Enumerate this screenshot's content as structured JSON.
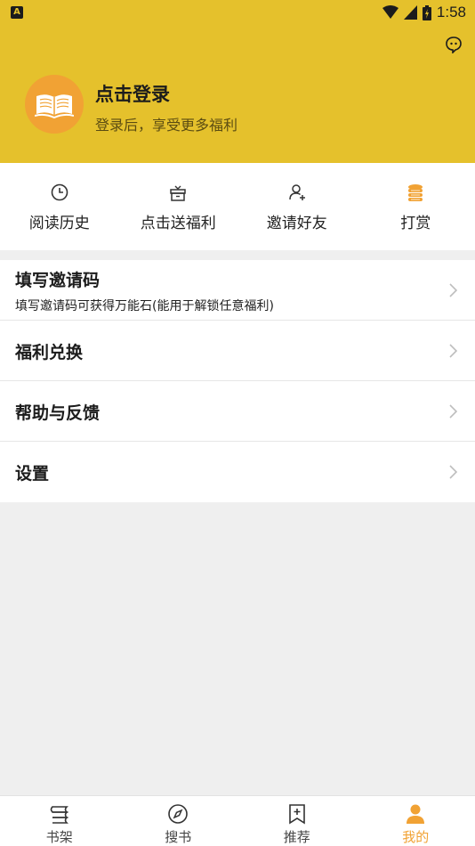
{
  "status": {
    "left_icon_letter": "A",
    "time": "1:58"
  },
  "profile": {
    "title": "点击登录",
    "subtitle": "登录后，享受更多福利"
  },
  "quick_actions": [
    {
      "label": "阅读历史",
      "icon": "clock-icon"
    },
    {
      "label": "点击送福利",
      "icon": "gift-icon"
    },
    {
      "label": "邀请好友",
      "icon": "add-user-icon"
    },
    {
      "label": "打赏",
      "icon": "coins-icon"
    }
  ],
  "menu": [
    {
      "title": "填写邀请码",
      "desc": "填写邀请码可获得万能石(能用于解锁任意福利)"
    },
    {
      "title": "福利兑换"
    },
    {
      "title": "帮助与反馈"
    },
    {
      "title": "设置"
    }
  ],
  "bottom_nav": [
    {
      "label": "书架",
      "icon": "bookshelf-icon"
    },
    {
      "label": "搜书",
      "icon": "compass-icon"
    },
    {
      "label": "推荐",
      "icon": "bookmark-plus-icon"
    },
    {
      "label": "我的",
      "icon": "person-icon",
      "active": true
    }
  ],
  "colors": {
    "header_bg": "#e5c12c",
    "accent": "#f1a234",
    "text": "#1c1c1c"
  }
}
